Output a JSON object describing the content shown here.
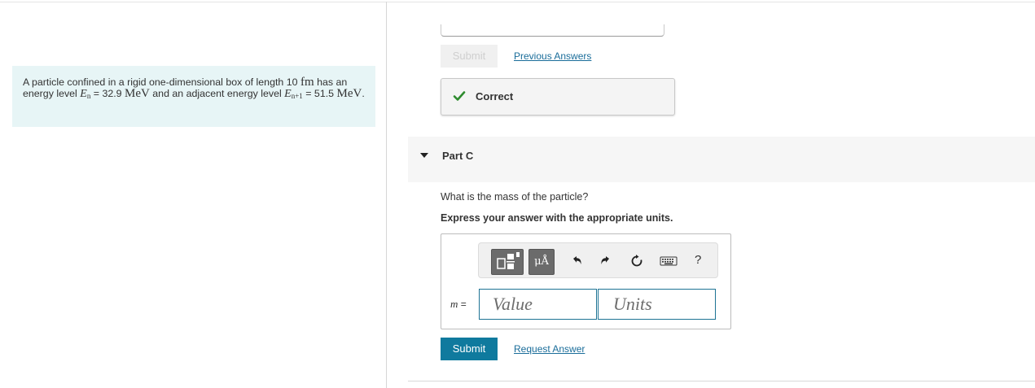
{
  "problem": {
    "text_1": "A particle confined in a rigid one-dimensional box of length 10 ",
    "unit_fm": "fm",
    "text_2": " has an energy level ",
    "en_var": "E",
    "en_sub": "n",
    "text_3": " = 32.9 ",
    "unit_mev": "MeV",
    "text_4": " and an adjacent energy level ",
    "en1_var": "E",
    "en1_sub": "n+1",
    "text_5": " = 51.5 ",
    "unit_mev2": "MeV",
    "text_6": "."
  },
  "part_b": {
    "submit_label": "Submit",
    "previous_answers_label": "Previous Answers",
    "feedback": "Correct"
  },
  "part_c": {
    "title": "Part C",
    "question": "What is the mass of the particle?",
    "instruction": "Express your answer with the appropriate units.",
    "toolbar": {
      "units_label": "μÅ",
      "help_label": "?"
    },
    "variable": "m",
    "equals": " =",
    "value_placeholder": "Value",
    "units_placeholder": "Units",
    "submit_label": "Submit",
    "request_answer_label": "Request Answer"
  },
  "colors": {
    "accent": "#0f7a9e",
    "link": "#1a6d9a",
    "problem_bg": "#e7f5f6",
    "correct_check": "#2e8b2e"
  },
  "icons": [
    "template-icon",
    "units-icon",
    "undo-icon",
    "redo-icon",
    "reset-icon",
    "keyboard-icon",
    "help-icon",
    "check-icon",
    "expand-triangle-icon"
  ]
}
